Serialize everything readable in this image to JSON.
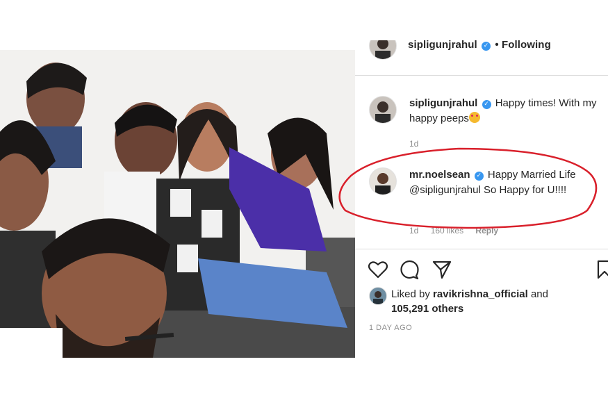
{
  "post": {
    "header": {
      "username": "sipligunjrahul",
      "follow_label": "Following"
    },
    "comments": [
      {
        "username": "sipligunjrahul",
        "text": "Happy times! With my happy peeps",
        "time": "1d",
        "likes": "",
        "reply": ""
      },
      {
        "username": "mr.noelsean",
        "text_pre": "Happy Married Life ",
        "mention": "@sipligunjrahul",
        "text_post": " So Happy for U!!!!",
        "time": "1d",
        "likes": "160 likes",
        "reply": "Reply"
      }
    ],
    "liked_by": {
      "prefix": "Liked by ",
      "user": "ravikrishna_official",
      "and": " and",
      "others": "105,291 others"
    },
    "time_ago": "1 DAY AGO"
  },
  "icons": [
    "heart-icon",
    "comment-icon",
    "share-icon",
    "bookmark-icon",
    "verified-badge-icon",
    "heart-eyes-emoji-icon"
  ],
  "colors": {
    "annotation": "#d9202b",
    "verified": "#3897f0",
    "muted": "#8e8e8e",
    "divider": "#dbdbdb"
  }
}
